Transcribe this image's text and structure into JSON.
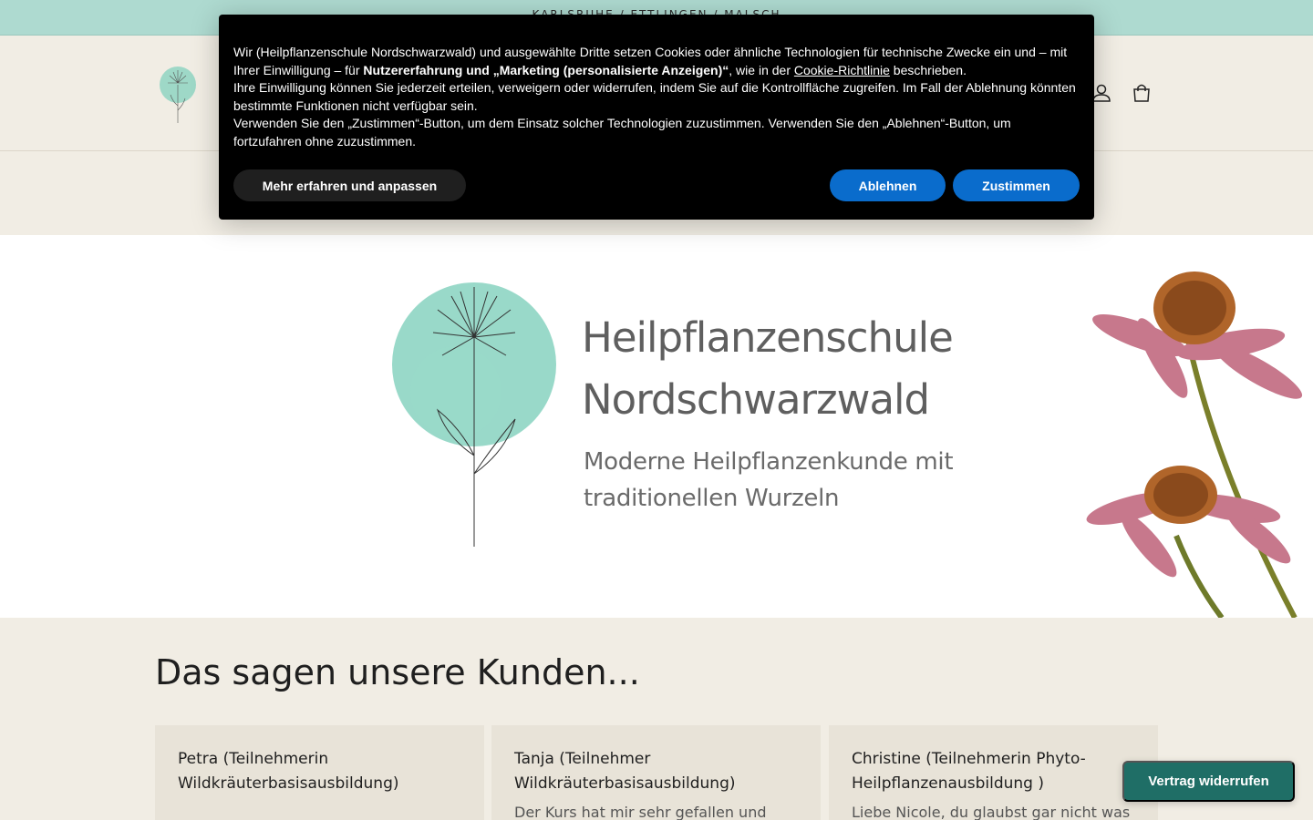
{
  "announcement": {
    "text": "KARLSRUHE / ETTLINGEN / MALSCH"
  },
  "header": {
    "account_icon": "account-icon",
    "cart_icon": "cart-icon"
  },
  "hero": {
    "title_line1": "Heilpflanzenschule",
    "title_line2": "Nordschwarzwald",
    "subtitle_line1": "Moderne Heilpflanzenkunde mit",
    "subtitle_line2": "traditionellen Wurzeln"
  },
  "testimonials": {
    "title": "Das sagen unsere Kunden...",
    "cards": [
      {
        "author": "Petra (Teilnehmerin Wildkräuterbasisausbildung)",
        "text": ""
      },
      {
        "author": "Tanja (Teilnehmer Wildkräuterbasisausbildung)",
        "text": "Der Kurs hat mir sehr gefallen und auch die"
      },
      {
        "author": "Christine (Teilnehmerin Phyto- Heilpflanzenausbildung )",
        "text": "Liebe Nicole, du glaubst gar nicht was für"
      }
    ]
  },
  "cookie": {
    "p1_a": "Wir (Heilpflanzenschule Nordschwarzwald) und ausgewählte Dritte setzen Cookies oder ähnliche Technologien für technische Zwecke ein und – mit Ihrer Einwilligung – für ",
    "p1_bold": "Nutzererfahrung und „Marketing (personalisierte Anzeigen)“",
    "p1_b": ", wie in der ",
    "p1_link": "Cookie-Richtlinie",
    "p1_c": " beschrieben.",
    "p2": "Ihre Einwilligung können Sie jederzeit erteilen, verweigern oder widerrufen, indem Sie auf die Kontrollfläche zugreifen. Im Fall der Ablehnung könnten bestimmte Funktionen nicht verfügbar sein.",
    "p3": "Verwenden Sie den „Zustimmen“-Button, um dem Einsatz solcher Technologien zuzustimmen. Verwenden Sie den „Ablehnen“-Button, um fortzufahren ohne zuzustimmen.",
    "more_label": "Mehr erfahren und anpassen",
    "decline_label": "Ablehnen",
    "accept_label": "Zustimmen"
  },
  "revoke_label": "Vertrag widerrufen",
  "colors": {
    "announce_bg": "#aedad0",
    "accent_button": "#0a6ccc",
    "revoke_bg": "#1f6e66",
    "page_bg": "#f1ede4"
  }
}
